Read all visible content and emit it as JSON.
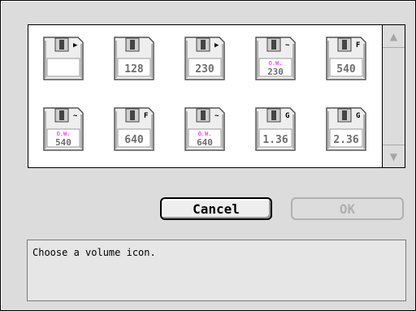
{
  "dialog": {
    "icons": [
      {
        "name": "floppy-default-icon",
        "label": "",
        "tag": "",
        "badge": "arrow"
      },
      {
        "name": "floppy-128-icon",
        "label": "128",
        "tag": "",
        "badge": "none"
      },
      {
        "name": "floppy-230-icon",
        "label": "230",
        "tag": "",
        "badge": "arrow"
      },
      {
        "name": "floppy-230-ow-icon",
        "label": "230",
        "tag": "O.W.",
        "badge": "wave"
      },
      {
        "name": "floppy-540-icon",
        "label": "540",
        "tag": "",
        "badge": "F"
      },
      {
        "name": "floppy-540-ow-icon",
        "label": "540",
        "tag": "O.W.",
        "badge": "wave"
      },
      {
        "name": "floppy-640-icon",
        "label": "640",
        "tag": "",
        "badge": "F"
      },
      {
        "name": "floppy-640-ow-icon",
        "label": "640",
        "tag": "O.W.",
        "badge": "wave"
      },
      {
        "name": "floppy-136-icon",
        "label": "1.36",
        "tag": "",
        "badge": "G"
      },
      {
        "name": "floppy-236-icon",
        "label": "2.36",
        "tag": "",
        "badge": "G"
      }
    ],
    "cancel_label": "Cancel",
    "ok_label": "OK",
    "status_text": "Choose a volume icon.",
    "colors": {
      "accent_ow": "#ff00ff"
    },
    "scroll_up_icon": "scroll-up-arrow-icon",
    "scroll_down_icon": "scroll-down-arrow-icon"
  }
}
